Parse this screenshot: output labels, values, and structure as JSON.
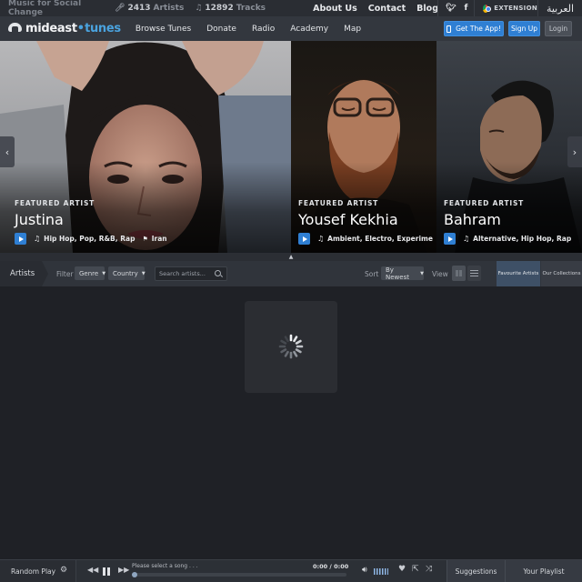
{
  "topbar": {
    "tagline": "Music for Social Change",
    "artists_count": "2413",
    "artists_label": "Artists",
    "tracks_count": "12892",
    "tracks_label": "Tracks",
    "links": [
      "About Us",
      "Contact",
      "Blog"
    ],
    "extension_label": "EXTENSION",
    "language": "العربية"
  },
  "nav": {
    "logo_part1": "mideast",
    "logo_sep": "•",
    "logo_part2": "tunes",
    "menu": [
      "Browse Tunes",
      "Donate",
      "Radio",
      "Academy",
      "Map"
    ],
    "get_app": "Get The App!",
    "signup": "Sign Up",
    "login": "Login"
  },
  "featured": [
    {
      "kicker": "FEATURED ARTIST",
      "name": "Justina",
      "genres": "Hip Hop, Pop, R&B, Rap",
      "country": "Iran"
    },
    {
      "kicker": "FEATURED ARTIST",
      "name": "Yousef Kekhia",
      "genres": "Ambient, Electro, Experime",
      "country": ""
    },
    {
      "kicker": "FEATURED ARTIST",
      "name": "Bahram",
      "genres": "Alternative, Hip Hop, Rap",
      "country": ""
    }
  ],
  "filterbar": {
    "section": "Artists",
    "filter_label": "Filter",
    "genre": "Genre",
    "country": "Country",
    "search_placeholder": "Search artists...",
    "sort_label": "Sort",
    "sort_value": "By Newest",
    "view_label": "View",
    "favourite_tab": "Favourite Artists",
    "collections_tab": "Our Collections"
  },
  "player": {
    "random_play": "Random Play",
    "status": "Please select a song . . .",
    "time": "0:00 / 0:00",
    "progress": 0,
    "suggestions": "Suggestions",
    "playlist": "Your Playlist"
  },
  "colors": {
    "accent": "#2f7fd3",
    "brand_blue": "#4aa3df",
    "background": "#1f2126"
  }
}
